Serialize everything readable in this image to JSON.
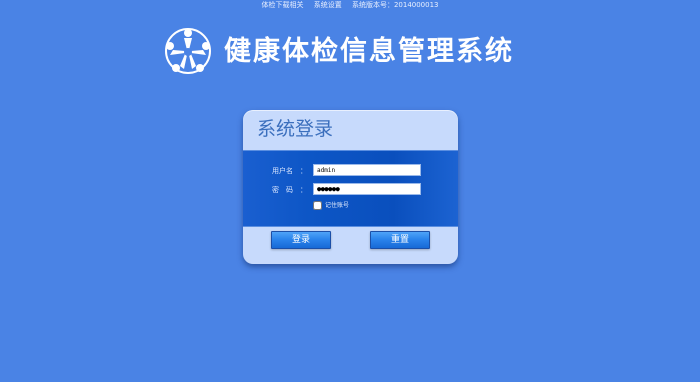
{
  "top_links": {
    "download": "体检下载相关",
    "settings": "系统设置",
    "version": "系统版本号：2014000013"
  },
  "app": {
    "title": "健康体检信息管理系统",
    "logo_icon": "five-people-star-logo-icon"
  },
  "login": {
    "title": "系统登录",
    "username_label": "用户名",
    "password_label": "密　码",
    "colon": "：",
    "username_value": "admin",
    "password_value": "●●●●●●",
    "remember_label": "记住账号",
    "remember_checked": false,
    "login_button": "登录",
    "reset_button": "重置"
  },
  "colors": {
    "background": "#4a83e5",
    "panel": "#c7dafc",
    "panel_body": "#0d56c6",
    "title_text": "#3b6fbd",
    "button": "#2b84ec"
  }
}
